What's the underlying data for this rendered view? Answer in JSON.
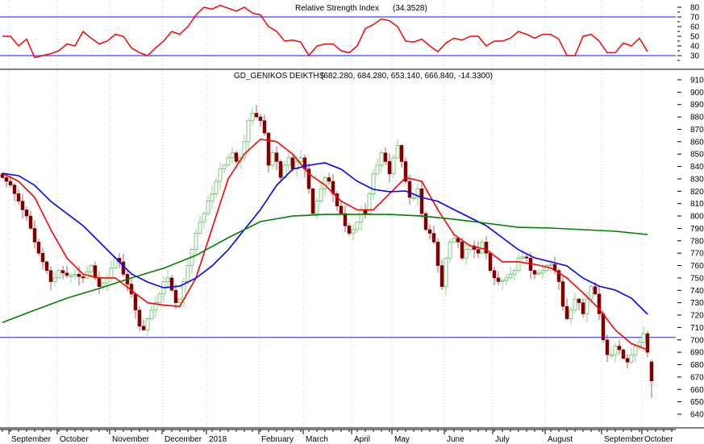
{
  "chart_data": [
    {
      "type": "line",
      "title": "Relative Strength Index",
      "title_value": "(34.3528)",
      "ylim": [
        20,
        85
      ],
      "yticks": [
        30,
        40,
        50,
        60,
        70,
        80
      ],
      "reference_lines": [
        70,
        30
      ],
      "series": [
        {
          "name": "RSI",
          "color": "#ff0000",
          "index_step": 2,
          "values": [
            50,
            50,
            40,
            47,
            28,
            30,
            32,
            35,
            42,
            40,
            55,
            48,
            42,
            45,
            52,
            50,
            38,
            33,
            30,
            38,
            45,
            55,
            52,
            60,
            72,
            80,
            78,
            82,
            79,
            76,
            80,
            74,
            72,
            60,
            55,
            45,
            46,
            44,
            30,
            40,
            42,
            42,
            35,
            33,
            40,
            58,
            62,
            68,
            66,
            60,
            45,
            44,
            47,
            40,
            34,
            43,
            48,
            46,
            50,
            50,
            40,
            45,
            45,
            48,
            55,
            52,
            48,
            52,
            52,
            47,
            30,
            30,
            50,
            52,
            45,
            33,
            33,
            43,
            40,
            48,
            34
          ]
        }
      ]
    },
    {
      "type": "candlestick",
      "title": "GD_GENIKOS DEIKTHS",
      "title_values": "(682.280, 684.280, 653.140, 666.840, -14.3300)",
      "ylim": [
        635,
        915
      ],
      "yticks": [
        640,
        650,
        660,
        670,
        680,
        690,
        700,
        710,
        720,
        730,
        740,
        750,
        760,
        770,
        780,
        790,
        800,
        810,
        820,
        830,
        840,
        850,
        860,
        870,
        880,
        890,
        900,
        910
      ],
      "reference_lines": [
        702
      ],
      "last_candle": {
        "open": 682.28,
        "high": 684.28,
        "low": 653.14,
        "close": 666.84,
        "change": -14.33
      },
      "closes": [
        831,
        828,
        825,
        818,
        812,
        805,
        800,
        790,
        779,
        770,
        763,
        756,
        747,
        750,
        756,
        754,
        752,
        752,
        753,
        751,
        750,
        755,
        760,
        750,
        743,
        746,
        750,
        758,
        766,
        763,
        753,
        745,
        737,
        724,
        711,
        708,
        717,
        724,
        730,
        737,
        747,
        750,
        740,
        730,
        733,
        747,
        760,
        773,
        786,
        795,
        802,
        812,
        818,
        828,
        838,
        841,
        847,
        851,
        844,
        847,
        860,
        877,
        883,
        880,
        877,
        867,
        841,
        851,
        844,
        831,
        841,
        847,
        838,
        844,
        847,
        838,
        822,
        802,
        812,
        822,
        831,
        828,
        818,
        808,
        802,
        792,
        786,
        789,
        795,
        805,
        802,
        818,
        834,
        841,
        851,
        844,
        834,
        847,
        857,
        844,
        828,
        815,
        815,
        822,
        802,
        789,
        786,
        779,
        760,
        743,
        766,
        779,
        782,
        779,
        766,
        773,
        776,
        773,
        770,
        779,
        770,
        756,
        750,
        747,
        748,
        750,
        753,
        756,
        766,
        767,
        766,
        756,
        753,
        754,
        756,
        760,
        761,
        756,
        747,
        727,
        717,
        724,
        733,
        730,
        721,
        733,
        743,
        737,
        721,
        700,
        688,
        688,
        695,
        692,
        685,
        682,
        688,
        695,
        698,
        705,
        690,
        667
      ],
      "moving_averages": [
        {
          "name": "short MA",
          "color": "#ff0000",
          "index_step": 4,
          "values": [
            834.5,
            828,
            815,
            789,
            766,
            753,
            750,
            750,
            740,
            730,
            728,
            727,
            750,
            790,
            830,
            850,
            862,
            860,
            850,
            834,
            825,
            812,
            805,
            805,
            818,
            831,
            828,
            805,
            785,
            776,
            773,
            763,
            763,
            761,
            758,
            750,
            738,
            725,
            708,
            697,
            692
          ]
        },
        {
          "name": "medium MA",
          "color": "#0000ff",
          "index_step": 4,
          "values": [
            834.5,
            832.6,
            824.8,
            811.8,
            802,
            792.2,
            779.2,
            766.2,
            753.2,
            746.7,
            742.1,
            743.4,
            749.9,
            759.7,
            772.7,
            789,
            805.2,
            824.8,
            837.8,
            841,
            843,
            837.8,
            828,
            821.5,
            819.6,
            820.2,
            815,
            811.8,
            805.2,
            798.7,
            792.2,
            782.5,
            772.7,
            766.2,
            763,
            759.7,
            749.9,
            743.4,
            740.2,
            733.7,
            720.7
          ]
        },
        {
          "name": "long MA",
          "color": "#008000",
          "index_step": 8,
          "values": [
            714,
            724,
            733.7,
            741.5,
            750,
            757.8,
            768.2,
            782.5,
            795.5,
            800,
            801.3,
            801.3,
            801.3,
            800,
            797.4,
            794.2,
            790.9,
            790.3,
            789,
            787.7,
            785
          ]
        }
      ],
      "up_color": "#5fbf5f",
      "down_color": "#800000"
    }
  ],
  "x_axis": {
    "months": [
      {
        "label": "September",
        "index": 2
      },
      {
        "label": "October",
        "index": 14
      },
      {
        "label": "November",
        "index": 27
      },
      {
        "label": "December",
        "index": 40
      },
      {
        "label": "2018",
        "index": 51
      },
      {
        "label": "February",
        "index": 64
      },
      {
        "label": "March",
        "index": 75
      },
      {
        "label": "April",
        "index": 87
      },
      {
        "label": "May",
        "index": 97
      },
      {
        "label": "June",
        "index": 110
      },
      {
        "label": "July",
        "index": 122
      },
      {
        "label": "August",
        "index": 135
      },
      {
        "label": "September",
        "index": 149
      },
      {
        "label": "October",
        "index": 159
      }
    ]
  },
  "colors": {
    "reference_line": "#4040ff",
    "grid": "#c8c8c8"
  }
}
